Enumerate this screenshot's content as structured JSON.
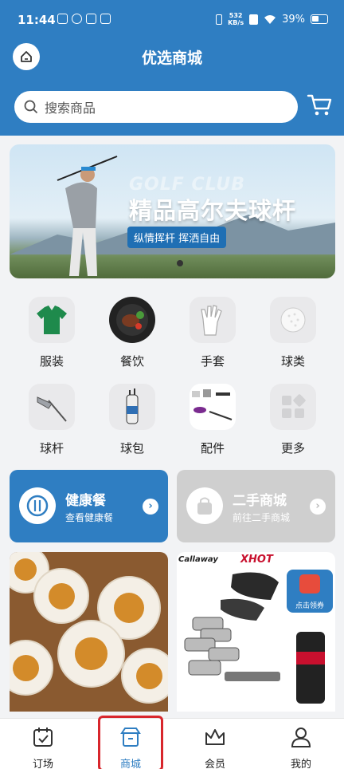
{
  "status_bar": {
    "time": "11:44",
    "speed_top": "532",
    "speed_unit": "KB/s",
    "battery": "39%"
  },
  "header": {
    "title": "优选商城"
  },
  "search": {
    "placeholder": "搜索商品"
  },
  "banner": {
    "ghost_text": "GOLF CLUB",
    "headline": "精品高尔夫球杆",
    "tagline": "纵情挥杆 挥洒自由"
  },
  "categories": [
    {
      "label": "服装",
      "icon": "polo-shirt-icon"
    },
    {
      "label": "餐饮",
      "icon": "steak-plate-icon"
    },
    {
      "label": "手套",
      "icon": "golf-glove-icon"
    },
    {
      "label": "球类",
      "icon": "golf-ball-icon"
    },
    {
      "label": "球杆",
      "icon": "golf-club-icon"
    },
    {
      "label": "球包",
      "icon": "golf-bag-icon"
    },
    {
      "label": "配件",
      "icon": "accessories-icon"
    },
    {
      "label": "更多",
      "icon": "more-grid-icon"
    }
  ],
  "promo_cards": [
    {
      "title": "健康餐",
      "subtitle": "查看健康餐",
      "icon": "fork-knife-icon"
    },
    {
      "title": "二手商城",
      "subtitle": "前往二手商城",
      "icon": "shopping-bag-icon"
    }
  ],
  "products": {
    "golf_brand": "Callaway",
    "golf_model": "XHOT",
    "coupon_label": "点击领券"
  },
  "tabbar": [
    {
      "label": "订场",
      "icon": "calendar-check-icon"
    },
    {
      "label": "商城",
      "icon": "store-icon",
      "active": true
    },
    {
      "label": "会员",
      "icon": "crown-icon"
    },
    {
      "label": "我的",
      "icon": "user-icon"
    }
  ],
  "colors": {
    "primary": "#2f7ec2",
    "highlight_box": "#d8262c",
    "second_hand_card": "#cfcfcf"
  }
}
